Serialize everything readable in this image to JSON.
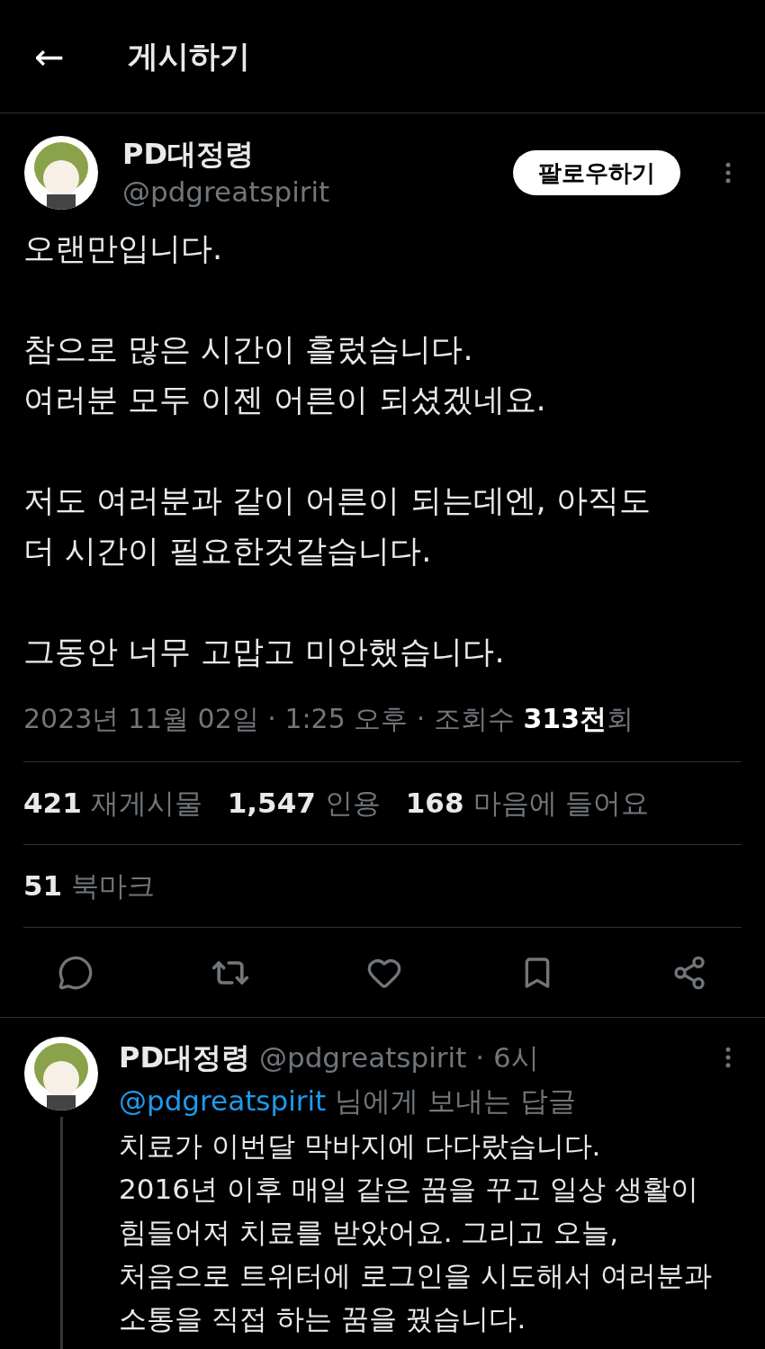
{
  "header": {
    "back": "←",
    "title": "게시하기"
  },
  "post": {
    "name": "PD대정령",
    "handle": "@pdgreatspirit",
    "follow": "팔로우하기",
    "paragraphs": [
      "오랜만입니다.",
      "참으로 많은 시간이 흘렀습니다.\n여러분 모두 이젠 어른이 되셨겠네요.",
      "저도 여러분과 같이 어른이 되는데엔, 아직도\n더 시간이 필요한것같습니다.",
      "그동안 너무 고맙고 미안했습니다."
    ],
    "meta": "2023년 11월 02일 · 1:25 오후 · 조회수 **313천**회",
    "stats": [
      {
        "count": "421",
        "label": "재게시물"
      },
      {
        "count": "1,547",
        "label": "인용"
      },
      {
        "count": "168",
        "label": "마음에 들어요"
      }
    ],
    "bookmarks": {
      "count": "51",
      "label": "북마크"
    }
  },
  "reply": {
    "name": "PD대정령",
    "handle": "@pdgreatspirit",
    "time": "· 6시",
    "reply_to": "@pdgreatspirit",
    "reply_to_suffix": "님에게 보내는 답글",
    "text": "치료가 이번달 막바지에 다다랐습니다.\n2016년 이후 매일 같은 꿈을 꾸고 일상 생활이\n힘들어져 치료를 받았어요. 그리고 오늘,\n처음으로 트위터에 로그인을 시도해서 여러분과\n소통을 직접 하는 꿈을 꿨습니다."
  }
}
